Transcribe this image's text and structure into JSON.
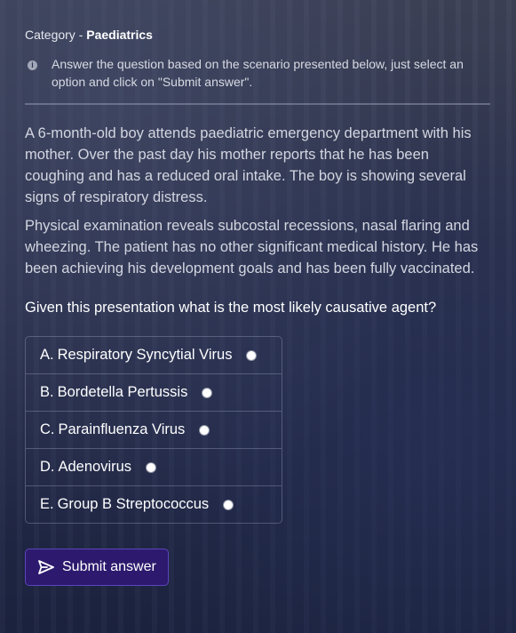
{
  "category": {
    "prefix": "Category - ",
    "name": "Paediatrics"
  },
  "instruction": {
    "icon": "info-icon",
    "text": "Answer the question based on the scenario presented below, just select an option and click on \"Submit answer\"."
  },
  "scenario": {
    "paragraph1": "A 6-month-old boy attends paediatric emergency department with his mother. Over the past day his mother reports that he has been coughing and has a reduced oral intake. The boy is showing several signs of respiratory distress.",
    "paragraph2": "Physical examination reveals subcostal recessions, nasal flaring and wheezing. The patient has no other significant medical history. He has been achieving his development goals and has been fully vaccinated."
  },
  "question": "Given this presentation what is the most likely causative agent?",
  "options": [
    {
      "letter": "A.",
      "label": "Respiratory Syncytial Virus",
      "selected": false
    },
    {
      "letter": "B.",
      "label": "Bordetella Pertussis",
      "selected": false
    },
    {
      "letter": "C.",
      "label": "Parainfluenza Virus",
      "selected": false
    },
    {
      "letter": "D.",
      "label": "Adenovirus",
      "selected": false
    },
    {
      "letter": "E.",
      "label": "Group B Streptococcus",
      "selected": false
    }
  ],
  "submit": {
    "label": "Submit answer",
    "icon": "send-icon"
  },
  "colors": {
    "button_bg": "#2d1a6e",
    "button_border": "#5c45b8"
  }
}
